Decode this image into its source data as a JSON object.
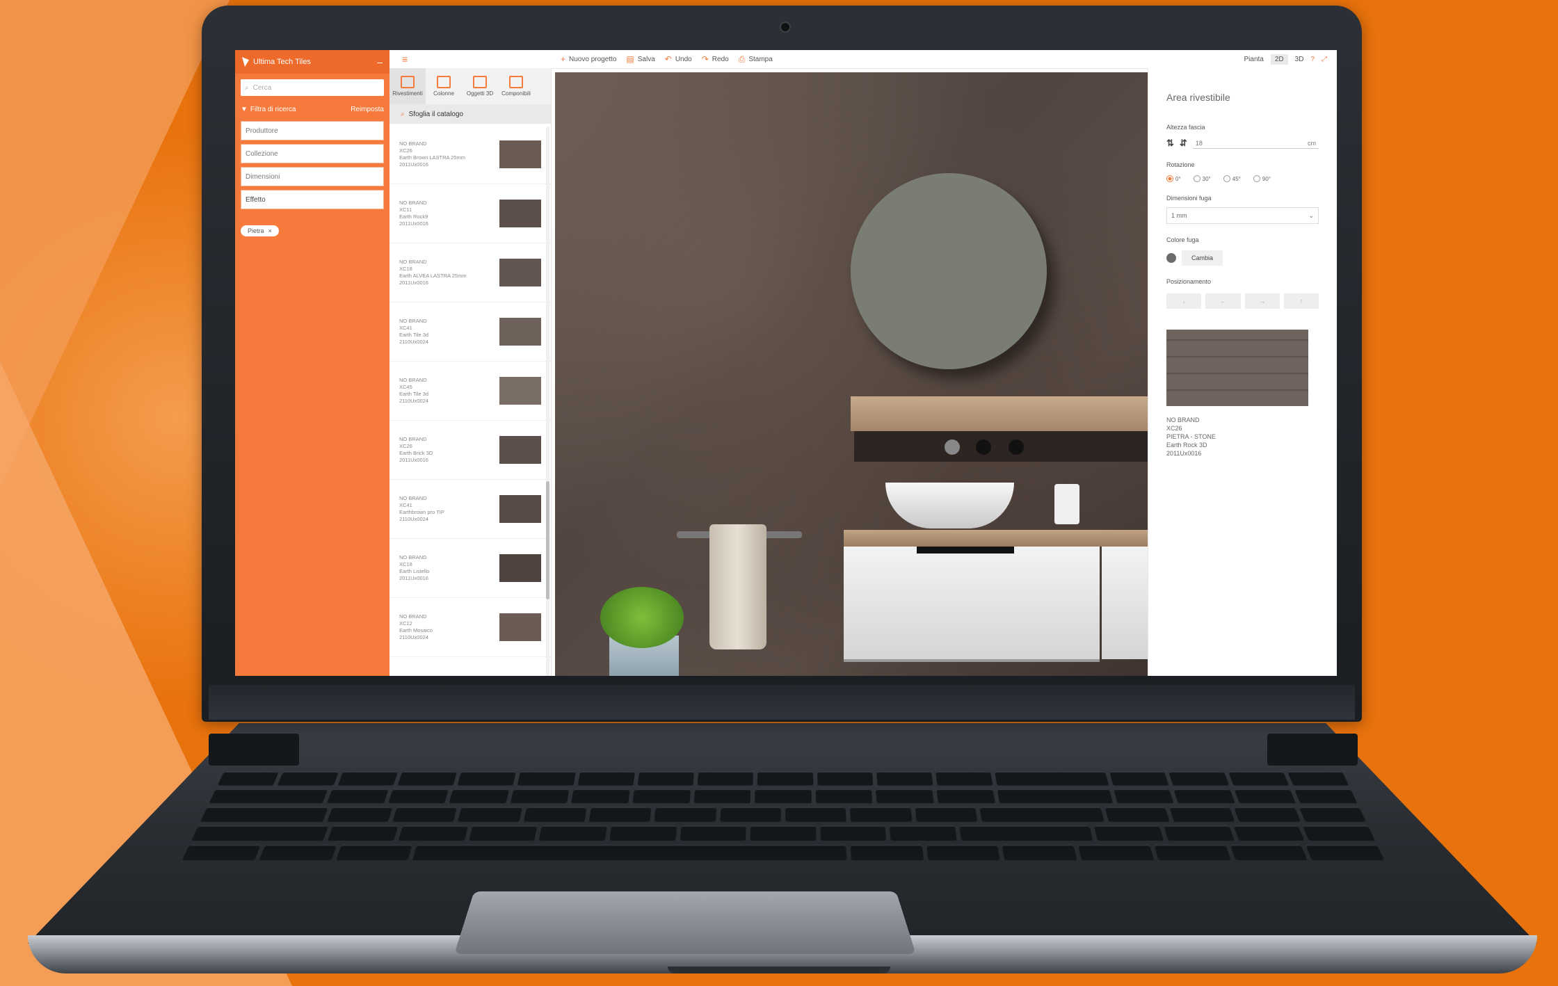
{
  "sidebar": {
    "title": "Ultima Tech Tiles",
    "search_placeholder": "Cerca",
    "filter_label": "Filtra di ricerca",
    "reset_label": "Reimposta",
    "fields": [
      "Produttore",
      "Collezione",
      "Dimensioni",
      "Effetto"
    ],
    "chip": "Pietra"
  },
  "catalog": {
    "tabs": [
      "Rivestimenti",
      "Colonne",
      "Oggetti 3D",
      "Componibili"
    ],
    "subheader": "Sfoglia il catalogo",
    "items": [
      {
        "brand": "NO BRAND",
        "code": "XC26",
        "name": "Earth Brown LASTRA 25mm",
        "extra": "2011Ux0016",
        "color": "#6a5a52"
      },
      {
        "brand": "NO BRAND",
        "code": "XC11",
        "name": "Earth Rock9",
        "extra": "2011Ux0016",
        "color": "#5c4f49"
      },
      {
        "brand": "NO BRAND",
        "code": "XC18",
        "name": "Earth ALVEA LASTRA 25mm",
        "extra": "2011Ux0016",
        "color": "#635650"
      },
      {
        "brand": "NO BRAND",
        "code": "XC41",
        "name": "Earth Tile 3d",
        "extra": "2110Ux0024",
        "color": "#6f625b"
      },
      {
        "brand": "NO BRAND",
        "code": "XC45",
        "name": "Earth Tile 3d",
        "extra": "2110Ux0024",
        "color": "#7a6d66"
      },
      {
        "brand": "NO BRAND",
        "code": "XC26",
        "name": "Earth Brick 3D",
        "extra": "2011Ux0016",
        "color": "#5d4f49"
      },
      {
        "brand": "NO BRAND",
        "code": "XC41",
        "name": "Earthbrown pro TIP",
        "extra": "2110Ux0024",
        "color": "#584b45"
      },
      {
        "brand": "NO BRAND",
        "code": "XC18",
        "name": "Earth Listello",
        "extra": "2011Ux0016",
        "color": "#4e433e"
      },
      {
        "brand": "NO BRAND",
        "code": "XC12",
        "name": "Earth Mosaico",
        "extra": "2110Ux0024",
        "color": "#6a5c55"
      }
    ]
  },
  "toolbar": {
    "new_project": "Nuovo progetto",
    "save": "Salva",
    "undo": "Undo",
    "redo": "Redo",
    "print": "Stampa",
    "view_label": "Pianta",
    "view_2d": "2D",
    "view_3d": "3D"
  },
  "properties": {
    "title": "Area rivestibile",
    "height_label": "Altezza fascia",
    "height_value": "18",
    "height_unit": "cm",
    "rotation_label": "Rotazione",
    "rotations": [
      "0°",
      "30°",
      "45°",
      "90°"
    ],
    "joint_size_label": "Dimensioni fuga",
    "joint_size_value": "1 mm",
    "joint_color_label": "Colore fuga",
    "joint_color_btn": "Cambia",
    "positioning_label": "Posizionamento",
    "positioning_btns": [
      "↓",
      "←",
      "→",
      "↑"
    ],
    "selected_tile": {
      "brand": "NO BRAND",
      "code": "XC26",
      "category": "PIETRA - STONE",
      "name": "Earth Rock 3D",
      "extra": "2011Ux0016"
    }
  }
}
